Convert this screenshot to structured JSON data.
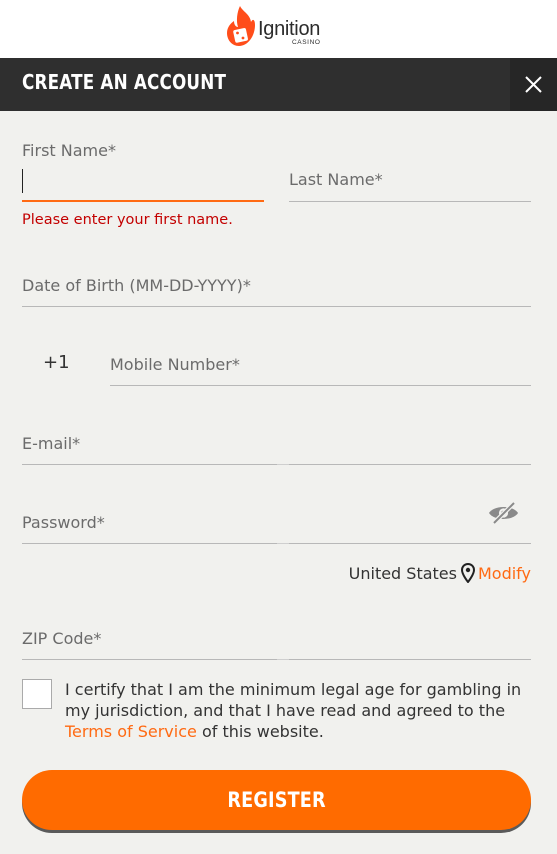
{
  "brand": {
    "name": "Ignition",
    "sub": "CASINO",
    "accent_color": "#ff6a13",
    "logo_icon": "flame-dice-icon"
  },
  "header": {
    "title": "CREATE AN ACCOUNT",
    "close_icon": "close-icon"
  },
  "form": {
    "first_name": {
      "label": "First Name*",
      "value": "",
      "error": "Please enter your first name."
    },
    "last_name": {
      "label": "Last Name*",
      "value": ""
    },
    "dob": {
      "label": "Date of Birth (MM-DD-YYYY)*",
      "value": ""
    },
    "phone": {
      "prefix": "+1",
      "label": "Mobile Number*",
      "value": ""
    },
    "email": {
      "label": "E-mail*",
      "value": ""
    },
    "password": {
      "label": "Password*",
      "value": "",
      "toggle_icon": "eye-slash-icon"
    },
    "location": {
      "country": "United States",
      "pin_icon": "map-pin-icon",
      "modify_label": "Modify"
    },
    "zip": {
      "label": "ZIP Code*",
      "value": ""
    },
    "certify": {
      "text_before": "I certify that I am the minimum legal age for gambling in my jurisdiction, and that I have read and agreed to the",
      "link": "Terms of Service",
      "text_after": "of this website.",
      "checked": false
    },
    "register_label": "REGISTER"
  },
  "colors": {
    "error": "#c30000",
    "header_bg": "#2f2f2f",
    "button": "#ff6b00"
  }
}
